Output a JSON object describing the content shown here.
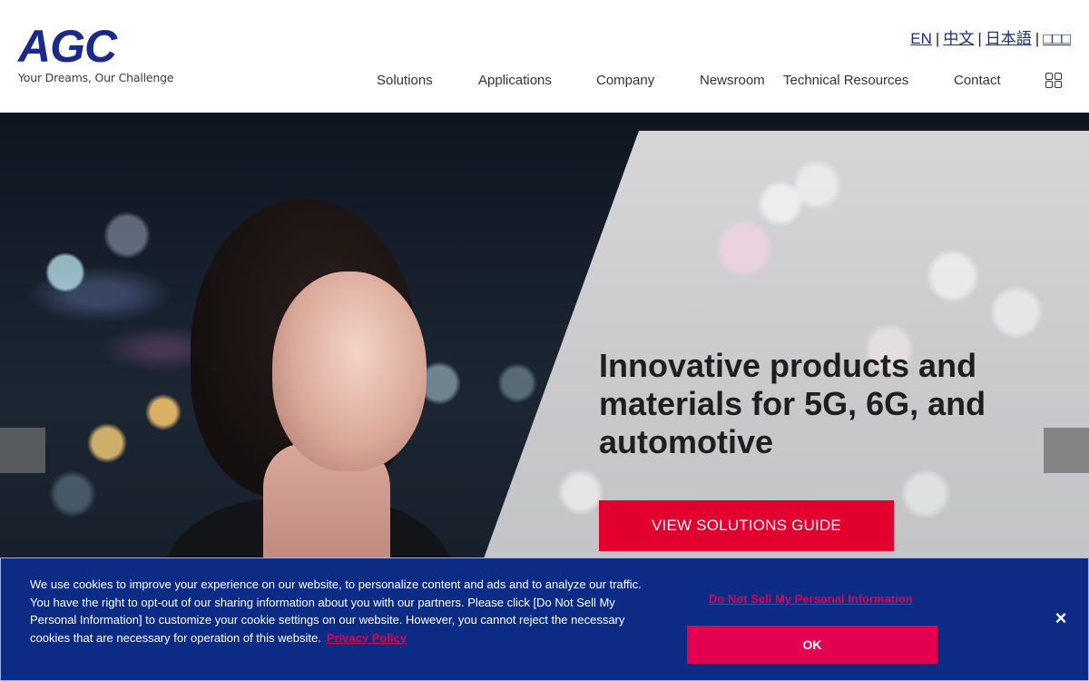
{
  "brand": {
    "logo_text": "AGC",
    "tagline": "Your Dreams, Our Challenge",
    "primary_color": "#1a2a8a",
    "accent_color": "#e2002e"
  },
  "languages": [
    {
      "label": "EN"
    },
    {
      "label": "中文"
    },
    {
      "label": "日本語"
    },
    {
      "label": "□□□"
    }
  ],
  "nav": {
    "items": [
      {
        "label": "Solutions"
      },
      {
        "label": "Applications"
      },
      {
        "label": "Company"
      },
      {
        "label": "Newsroom"
      },
      {
        "label": "Technical Resources"
      },
      {
        "label": "Contact"
      }
    ],
    "menu_icon": "grid-menu-icon"
  },
  "hero": {
    "title": "Innovative products and materials for 5G, 6G, and automotive",
    "cta_label": "VIEW SOLUTIONS GUIDE"
  },
  "cookie_banner": {
    "text": "We use cookies to improve your experience on our website, to personalize content and ads and to analyze our traffic. You have the right to opt-out of our sharing information about you with our partners. Please click [Do Not Sell My Personal Information] to customize your cookie settings on our website. However, you cannot reject the necessary cookies that are necessary for operation of this website.",
    "privacy_link": "Privacy Policy",
    "do_not_sell_link": "Do Not Sell My Personal Information",
    "ok_label": "OK",
    "close_label": "×",
    "background_color": "#0b2b85",
    "link_color": "#e2004f"
  }
}
